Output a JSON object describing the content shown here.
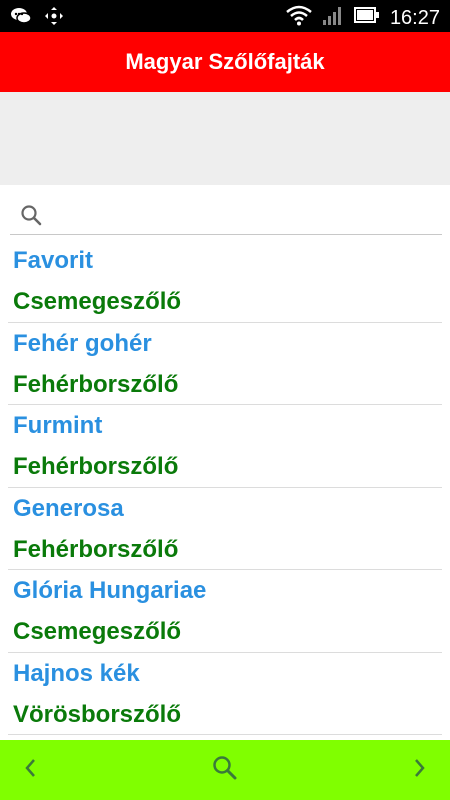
{
  "statusbar": {
    "time": "16:27",
    "icons": [
      "chat-icon",
      "move-icon",
      "wifi-icon",
      "signal-icon",
      "battery-icon"
    ]
  },
  "appbar": {
    "title": "Magyar Szőlőfajták"
  },
  "search": {
    "placeholder": "",
    "value": ""
  },
  "list": {
    "items": [
      {
        "name": "Favorit",
        "type": "Csemegeszőlő"
      },
      {
        "name": "Fehér gohér",
        "type": "Fehérborszőlő"
      },
      {
        "name": "Furmint",
        "type": "Fehérborszőlő"
      },
      {
        "name": "Generosa",
        "type": "Fehérborszőlő"
      },
      {
        "name": "Glória Hungariae",
        "type": "Csemegeszőlő"
      },
      {
        "name": "Hajnos kék",
        "type": "Vörösborszőlő"
      }
    ]
  },
  "bottombar": {
    "prev_icon": "chevron-left-icon",
    "search_icon": "search-icon",
    "next_icon": "chevron-right-icon"
  },
  "colors": {
    "appbar": "#ff0000",
    "bottombar": "#80ff00",
    "name_text": "#2a90e0",
    "type_text": "#0a7a0a"
  }
}
